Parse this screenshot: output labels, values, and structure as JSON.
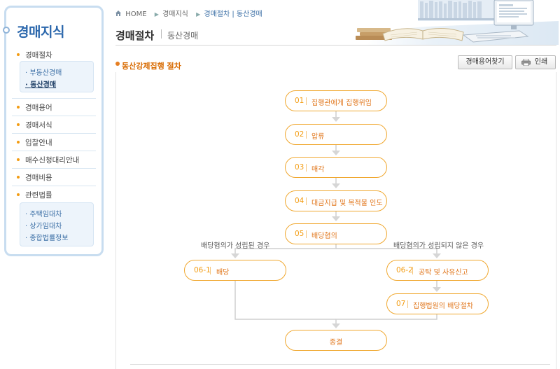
{
  "sidebar": {
    "title": "경매지식",
    "menu": [
      {
        "label": "경매절차",
        "sub": [
          "부동산경매",
          "동산경매"
        ],
        "active_sub": 1
      },
      {
        "label": "경매용어"
      },
      {
        "label": "경매서식"
      },
      {
        "label": "입찰안내"
      },
      {
        "label": "매수신청대리안내"
      },
      {
        "label": "경매비용"
      },
      {
        "label": "관련법률",
        "sub": [
          "주택임대차",
          "상가임대차",
          "종합법률정보"
        ]
      }
    ]
  },
  "breadcrumb": [
    "HOME",
    "경매지식",
    "경매절차 | 동산경매"
  ],
  "page": {
    "title": "경매절차",
    "subtitle": "동산경매"
  },
  "section": {
    "title": "동산강제집행 절차",
    "glossary_button": "경매용어찾기",
    "print_button": "인쇄"
  },
  "flow": {
    "steps": [
      {
        "num": "01",
        "label": "집행관에게 집행위임"
      },
      {
        "num": "02",
        "label": "압류"
      },
      {
        "num": "03",
        "label": "매각"
      },
      {
        "num": "04",
        "label": "대금지급 및 목적물 인도"
      },
      {
        "num": "05",
        "label": "배당협의"
      }
    ],
    "branch_left_condition": "배당협의가 성립된 경우",
    "branch_right_condition": "배당협의가 성립되지 않은 경우",
    "left_step": {
      "num": "06-1",
      "label": "배당"
    },
    "right_steps": [
      {
        "num": "06-2",
        "label": "공탁 및 사유신고"
      },
      {
        "num": "07",
        "label": "집행법원의 배당절차"
      }
    ],
    "end_label": "종결"
  },
  "colors": {
    "accent": "#f39c12",
    "node_border": "#f0a830",
    "sidebar_title": "#2b67ac",
    "connector": "#cfcfcf"
  }
}
